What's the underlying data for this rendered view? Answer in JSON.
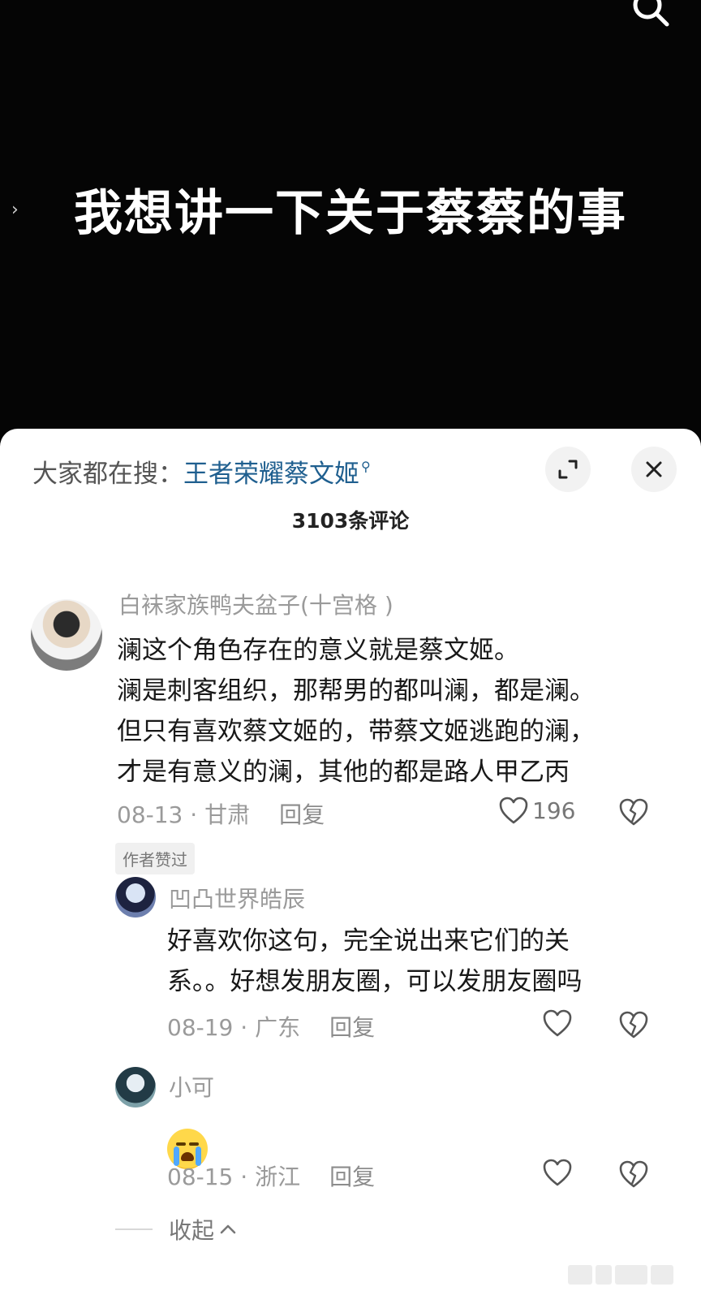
{
  "video": {
    "title": "我想讲一下关于蔡蔡的事",
    "side_arrow": "›"
  },
  "sheet": {
    "search_prefix": "大家都在搜：",
    "search_keyword": "王者荣耀蔡文姬",
    "comment_count": "3103条评论"
  },
  "comments": [
    {
      "username": "白袜家族鸭夫盆子(十宫格 )",
      "text": "澜这个角色存在的意义就是蔡文姬。\n澜是刺客组织，那帮男的都叫澜，都是澜。\n但只有喜欢蔡文姬的，带蔡文姬逃跑的澜，\n才是有意义的澜，其他的都是路人甲乙丙",
      "date_location": "08-13 · 甘肃",
      "reply_label": "回复",
      "like_count": "196",
      "badge": "作者赞过",
      "replies": [
        {
          "username": "凹凸世界皓辰",
          "text": "好喜欢你这句，完全说出来它们的关\n系。。好想发朋友圈，可以发朋友圈吗",
          "date_location": "08-19 · 广东",
          "reply_label": "回复"
        },
        {
          "username": "小可",
          "text": "",
          "emoji": "loudly-crying-face",
          "date_location": "08-15 · 浙江",
          "reply_label": "回复"
        }
      ]
    }
  ],
  "collapse_label": "收起",
  "icons": {
    "search": "search-icon",
    "expand": "expand-icon",
    "close": "close-icon",
    "like": "heart-icon",
    "dislike": "broken-heart-icon",
    "collapse": "chevron-up-icon"
  },
  "colors": {
    "keyword_link": "#1f5f8f",
    "meta_gray": "#9a9a9a"
  }
}
